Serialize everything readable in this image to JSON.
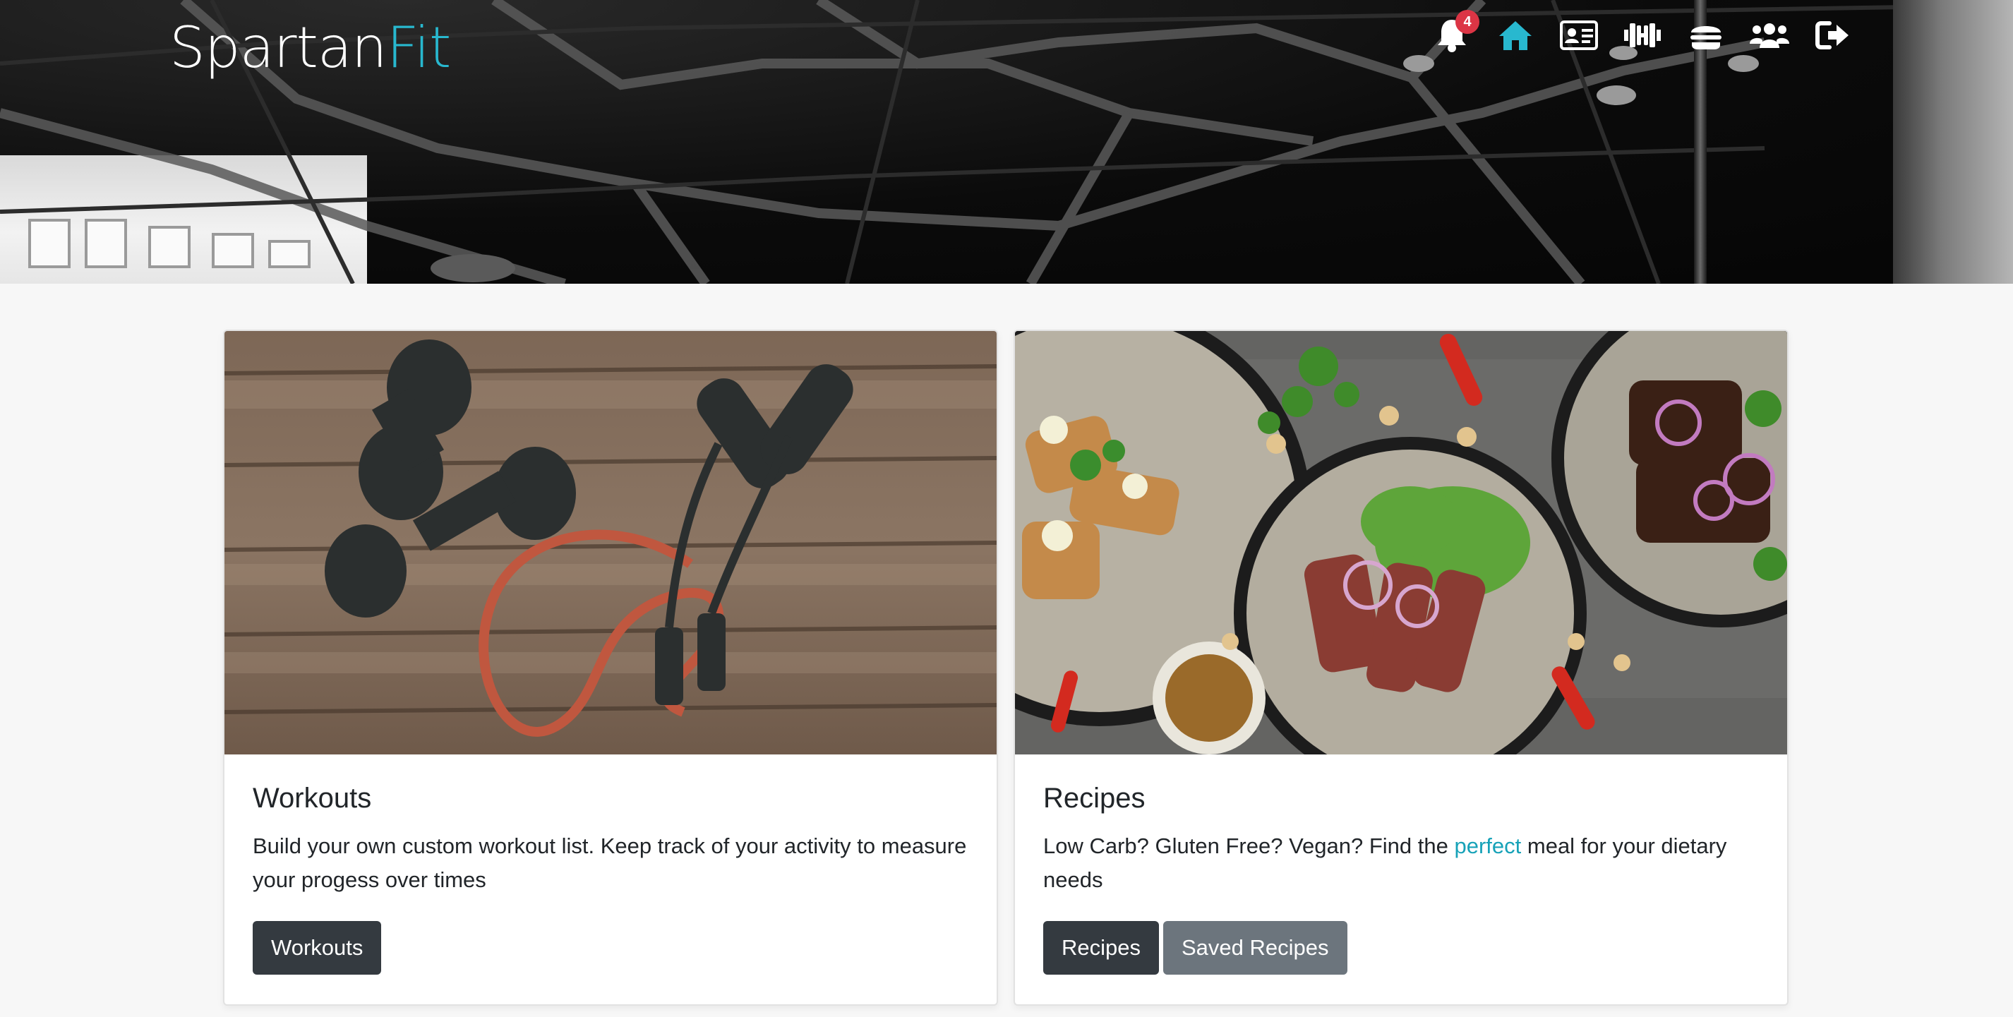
{
  "brand": {
    "part1": "Spartan",
    "part2": "Fit"
  },
  "nav": {
    "notification_count": "4",
    "items": [
      "notifications-icon",
      "home-icon",
      "profile-card-icon",
      "dumbbell-icon",
      "burger-icon",
      "users-icon",
      "logout-icon"
    ],
    "active": "home-icon"
  },
  "cards": {
    "workouts": {
      "title": "Workouts",
      "text": "Build your own custom workout list. Keep track of your activity to measure your progess over times",
      "button": "Workouts"
    },
    "recipes": {
      "title": "Recipes",
      "text_before": "Low Carb? Gluten Free? Vegan? Find the ",
      "text_highlight": "perfect",
      "text_after": " meal for your dietary needs",
      "button_primary": "Recipes",
      "button_secondary": "Saved Recipes"
    }
  },
  "colors": {
    "accent": "#28b8cf",
    "badge": "#dc3545",
    "button_dark": "#343a40",
    "button_gray": "#6c757d",
    "highlight": "#17a2b8"
  }
}
